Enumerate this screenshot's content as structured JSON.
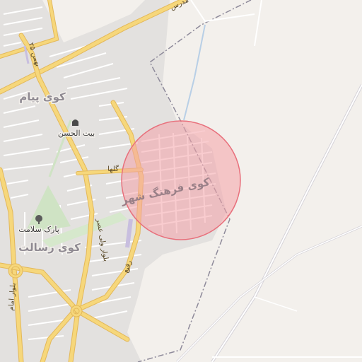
{
  "map": {
    "colors": {
      "land": "#f3f0ec",
      "urban": "#e3e1df",
      "major_road": "#f6d77b",
      "major_road_casing": "#e3b85a",
      "minor_road": "#ffffff",
      "park": "#cfe3c4",
      "boundary": "#8e8a9a",
      "water": "#b8cfe6",
      "highlight_fill": "#f4a2a8",
      "highlight_stroke": "#e8707c"
    },
    "districts": {
      "kooy_payam": "کوی پیام",
      "kooy_farhang_shahr": "کوی فرهنگ شهر",
      "kooy_resalat": "کوی رسالت"
    },
    "pois": {
      "beit_al_hassan": "بیت الحسن",
      "park_salamat": "پارک سلامت"
    },
    "roads": {
      "modares": "مدرس",
      "bahman_25": "۲۵ بهمن",
      "golha": "گلها",
      "boulevard_omar": "بلوار ولی عصر",
      "rafi": "رفیع",
      "imam_boulevard": "بلوار امام"
    },
    "icons": {
      "beit_al_hassan": "mosque-icon",
      "park_salamat": "tree-icon"
    }
  }
}
